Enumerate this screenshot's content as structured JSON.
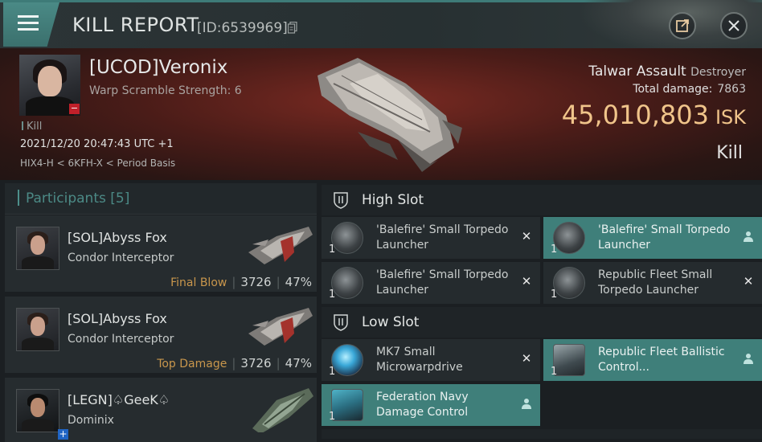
{
  "header": {
    "title": "KILL REPORT",
    "id_text": "[ID:6539969]"
  },
  "victim": {
    "name": "[UCOD]Veronix",
    "scramble": "Warp Scramble Strength: 6",
    "kill_label": "Kill",
    "datetime": "2021/12/20 20:47:43 UTC +1",
    "location": "HIX4-H < 6KFH-X < Period Basis",
    "ship_name": "Talwar Assault",
    "ship_class": "Destroyer",
    "total_damage_label": "Total damage:",
    "total_damage": "7863",
    "isk_value": "45,010,803",
    "isk_unit": "ISK",
    "result": "Kill"
  },
  "participants": {
    "label": "Participants",
    "count": "[5]",
    "items": [
      {
        "name": "[SOL]Abyss Fox",
        "ship": "Condor Interceptor",
        "tag": "Final Blow",
        "damage": "3726",
        "percent": "47%"
      },
      {
        "name": "[SOL]Abyss Fox",
        "ship": "Condor Interceptor",
        "tag": "Top Damage",
        "damage": "3726",
        "percent": "47%"
      },
      {
        "name": "[LEGN]♤GeeK♤",
        "ship": "Dominix",
        "tag": "",
        "damage": "",
        "percent": ""
      }
    ]
  },
  "slots": {
    "high_title": "High Slot",
    "low_title": "Low Slot",
    "high": [
      {
        "qty": "1",
        "name": "'Balefire' Small Torpedo Launcher",
        "status": "×"
      },
      {
        "qty": "1",
        "name": "'Balefire' Small Torpedo Launcher",
        "status": "person"
      },
      {
        "qty": "1",
        "name": "'Balefire' Small Torpedo Launcher",
        "status": "×"
      },
      {
        "qty": "1",
        "name": "Republic Fleet Small Torpedo Launcher",
        "status": "×"
      }
    ],
    "low": [
      {
        "qty": "1",
        "name": "MK7 Small Microwarpdrive",
        "status": "×"
      },
      {
        "qty": "1",
        "name": "Republic Fleet Ballistic Control...",
        "status": "person"
      },
      {
        "qty": "1",
        "name": "Federation Navy Damage Control",
        "status": "person"
      }
    ]
  },
  "colors": {
    "accent": "#4d8f8b",
    "isk": "#f0c48a",
    "highlight": "#3f7f7a",
    "tag": "#c8964c",
    "destroyed_badge": "#c0202a"
  },
  "icons": [
    "menu-icon",
    "copy-icon",
    "external-link-icon",
    "close-icon",
    "shield-icon",
    "person-icon",
    "x-icon"
  ]
}
